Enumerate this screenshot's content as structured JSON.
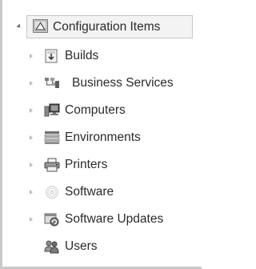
{
  "tree": {
    "root": {
      "label": "Configuration Items",
      "icon": "configuration-items-icon",
      "expanded": true,
      "selected": true
    },
    "children": [
      {
        "key": "builds",
        "label": "Builds",
        "icon": "builds-icon"
      },
      {
        "key": "business-services",
        "label": "Business Services",
        "icon": "business-services-icon"
      },
      {
        "key": "computers",
        "label": "Computers",
        "icon": "computers-icon"
      },
      {
        "key": "environments",
        "label": "Environments",
        "icon": "environments-icon"
      },
      {
        "key": "printers",
        "label": "Printers",
        "icon": "printers-icon"
      },
      {
        "key": "software",
        "label": "Software",
        "icon": "software-icon"
      },
      {
        "key": "software-updates",
        "label": "Software Updates",
        "icon": "software-updates-icon"
      },
      {
        "key": "users",
        "label": "Users",
        "icon": "users-icon"
      }
    ]
  }
}
